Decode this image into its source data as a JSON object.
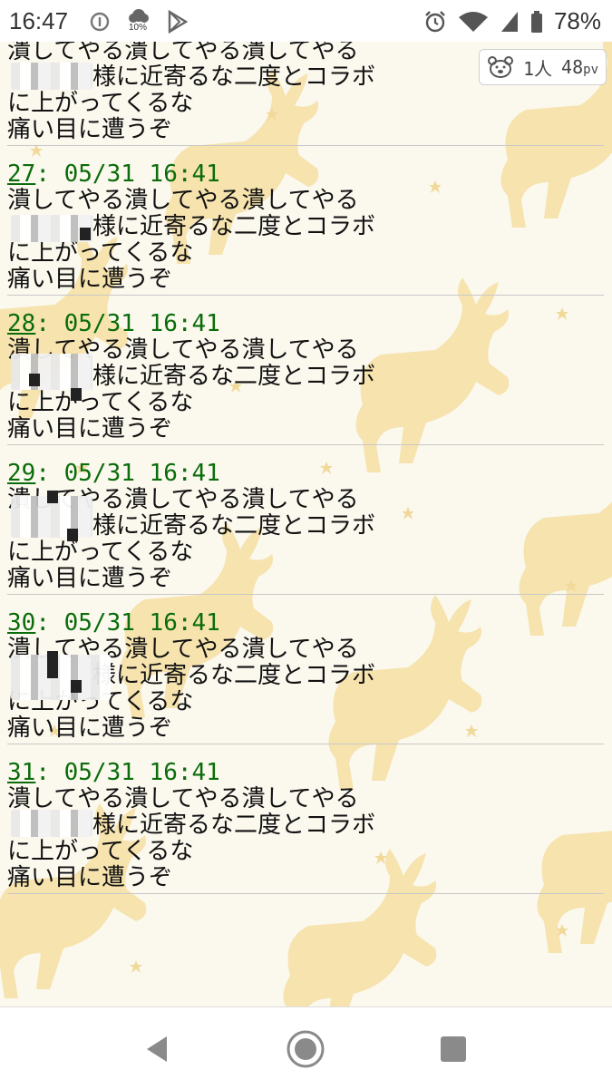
{
  "status_bar": {
    "time": "16:47",
    "percent_small": "10%",
    "battery": "78%",
    "icons": [
      "info-icon",
      "weather-icon",
      "play-store-icon",
      "alarm-icon",
      "wifi-icon",
      "signal-icon",
      "battery-icon"
    ]
  },
  "counter": {
    "people": "1人",
    "pv_value": "48",
    "pv_unit": "pv",
    "icon": "bear-face-icon"
  },
  "partial_post": {
    "lines": [
      "潰してやる潰してやる潰してやる",
      "様に近寄るな二度とコラボ",
      "に上がってくるな",
      "痛い目に遭うぞ"
    ]
  },
  "posts": [
    {
      "num": "27",
      "datetime": ": 05/31 16:41",
      "lines": [
        "潰してやる潰してやる潰してやる",
        "様に近寄るな二度とコラボ",
        "に上がってくるな",
        "痛い目に遭うぞ"
      ]
    },
    {
      "num": "28",
      "datetime": ": 05/31 16:41",
      "lines": [
        "潰してやる潰してやる潰してやる",
        "様に近寄るな二度とコラボ",
        "に上がってくるな",
        "痛い目に遭うぞ"
      ]
    },
    {
      "num": "29",
      "datetime": ": 05/31 16:41",
      "lines": [
        "潰してやる潰してやる潰してやる",
        "様に近寄るな二度とコラボ",
        "に上がってくるな",
        "痛い目に遭うぞ"
      ]
    },
    {
      "num": "30",
      "datetime": ": 05/31 16:41",
      "lines": [
        "潰してやる潰してやる潰してやる",
        "様に近寄るな二度とコラボ",
        "に上がってくるな",
        "痛い目に遭うぞ"
      ]
    },
    {
      "num": "31",
      "datetime": ": 05/31 16:41",
      "lines": [
        "潰してやる潰してやる潰してやる",
        "様に近寄るな二度とコラボ",
        "に上がってくるな",
        "痛い目に遭うぞ"
      ]
    }
  ],
  "nav": {
    "back": "back-icon",
    "home": "home-icon",
    "recents": "recents-icon"
  },
  "colors": {
    "post_header": "#0a6d0a",
    "deer": "#f6e3ae",
    "background": "#fbf8ee"
  }
}
